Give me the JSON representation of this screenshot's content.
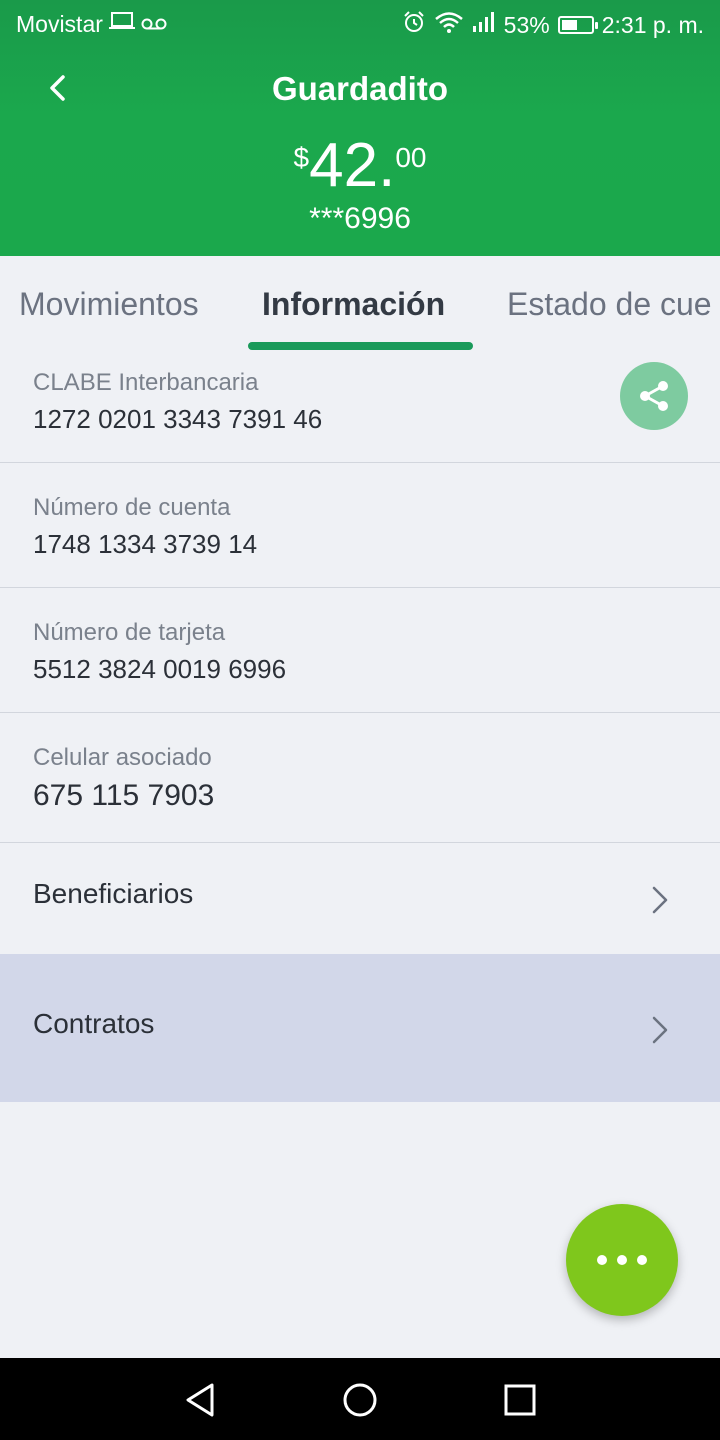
{
  "status_bar": {
    "carrier": "Movistar",
    "battery_percent": "53%",
    "battery_level": 0.53,
    "time": "2:31 p. m.",
    "icons": [
      "laptop-icon",
      "voicemail-icon",
      "alarm-icon",
      "wifi-icon",
      "signal-icon",
      "battery-icon"
    ]
  },
  "header": {
    "title": "Guardadito",
    "balance": {
      "currency": "$",
      "integer": "42.",
      "decimals": "00"
    },
    "account_masked": "***6996"
  },
  "tabs": [
    {
      "label": "Movimientos",
      "active": false
    },
    {
      "label": "Información",
      "active": true
    },
    {
      "label": "Estado de cue",
      "active": false
    }
  ],
  "info": [
    {
      "label": "CLABE Interbancaria",
      "value": "1272 0201 3343 7391 46"
    },
    {
      "label": "Número de cuenta",
      "value": "1748 1334 3739 14"
    },
    {
      "label": "Número de tarjeta",
      "value": "5512 3824 0019 6996"
    },
    {
      "label": "Celular asociado",
      "value": "675 115 7903"
    }
  ],
  "links": [
    {
      "label": "Beneficiarios"
    },
    {
      "label": "Contratos"
    }
  ],
  "colors": {
    "header_green": "#1ba84d",
    "tab_underline": "#1a9a5a",
    "share_button": "#7ecba0",
    "fab": "#7fc71c",
    "selected_row": "#d2d7e9"
  }
}
